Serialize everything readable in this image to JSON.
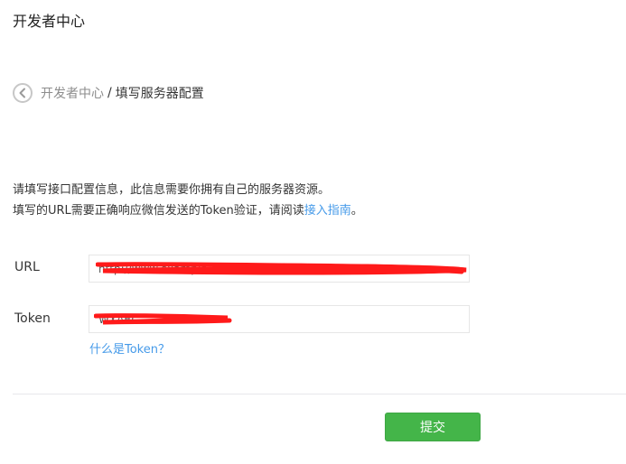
{
  "header": {
    "title": "开发者中心"
  },
  "breadcrumb": {
    "back_icon": "chevron-left-icon",
    "parent": "开发者中心",
    "separator": "/",
    "current": "填写服务器配置"
  },
  "description": {
    "line1": "请填写接口配置信息，此信息需要你拥有自己的服务器资源。",
    "line2_prefix": "填写的URL需要正确响应微信发送的Token验证，请阅读",
    "line2_link": "接入指南",
    "line2_suffix": "。"
  },
  "form": {
    "url_label": "URL",
    "url_value": "http://www.example.com/API/...............?..........WXBB1",
    "token_label": "Token",
    "token_value": "WXABC...............",
    "token_help": "什么是Token？"
  },
  "actions": {
    "submit_label": "提交"
  },
  "colors": {
    "accent_link": "#459ae9",
    "primary_button": "#44b549",
    "redaction": "#ff0000"
  }
}
